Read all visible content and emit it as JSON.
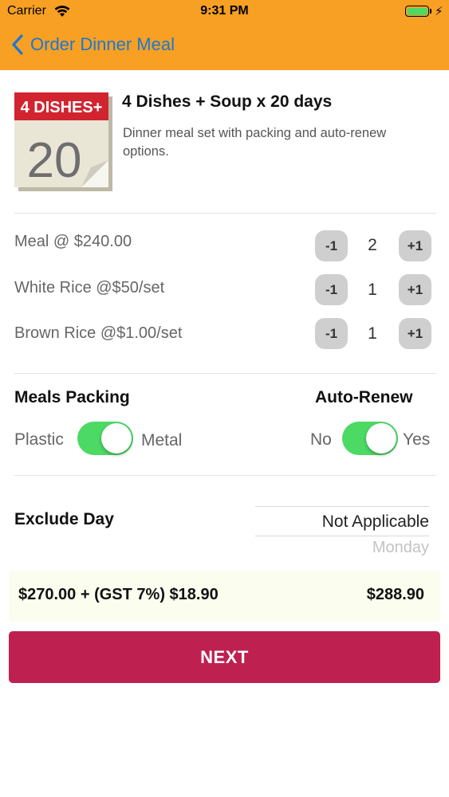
{
  "status_bar": {
    "carrier": "Carrier",
    "time": "9:31 PM",
    "battery_icon": "battery-charging-icon"
  },
  "nav": {
    "back_icon": "chevron-left-icon",
    "title": "Order Dinner Meal",
    "accent": "#1A78D6",
    "bar_color": "#F7A023"
  },
  "product": {
    "thumb_banner": "4 DISHES+",
    "thumb_number": "20",
    "title": "4 Dishes + Soup x 20 days",
    "description": "Dinner meal set with packing and auto-renew options."
  },
  "quantities": [
    {
      "label": "Meal @ $240.00",
      "minus": "-1",
      "value": "2",
      "plus": "+1"
    },
    {
      "label": "White Rice @$50/set",
      "minus": "-1",
      "value": "1",
      "plus": "+1"
    },
    {
      "label": "Brown Rice @$1.00/set",
      "minus": "-1",
      "value": "1",
      "plus": "+1"
    }
  ],
  "packing": {
    "label": "Meals Packing",
    "left_option": "Plastic",
    "right_option": "Metal",
    "on": true
  },
  "auto_renew": {
    "label": "Auto-Renew",
    "left_option": "No",
    "right_option": "Yes",
    "on": true
  },
  "exclude_day": {
    "label": "Exclude Day",
    "selected": "Not Applicable",
    "next_option": "Monday"
  },
  "totals": {
    "breakdown": "$270.00 + (GST 7%) $18.90",
    "total": "$288.90"
  },
  "next_button": {
    "label": "NEXT",
    "color": "#BE2150"
  }
}
